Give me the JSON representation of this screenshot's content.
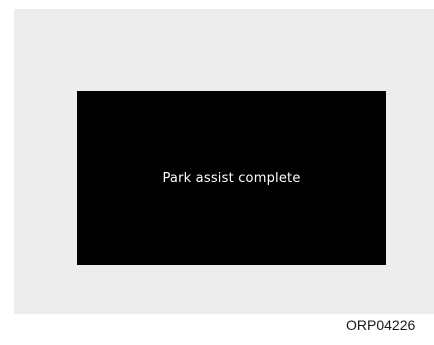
{
  "display": {
    "message": "Park assist complete"
  },
  "figure": {
    "code": "ORP04226"
  },
  "colors": {
    "background_panel": "#ededed",
    "screen": "#000000",
    "message_text": "#ffffff"
  }
}
